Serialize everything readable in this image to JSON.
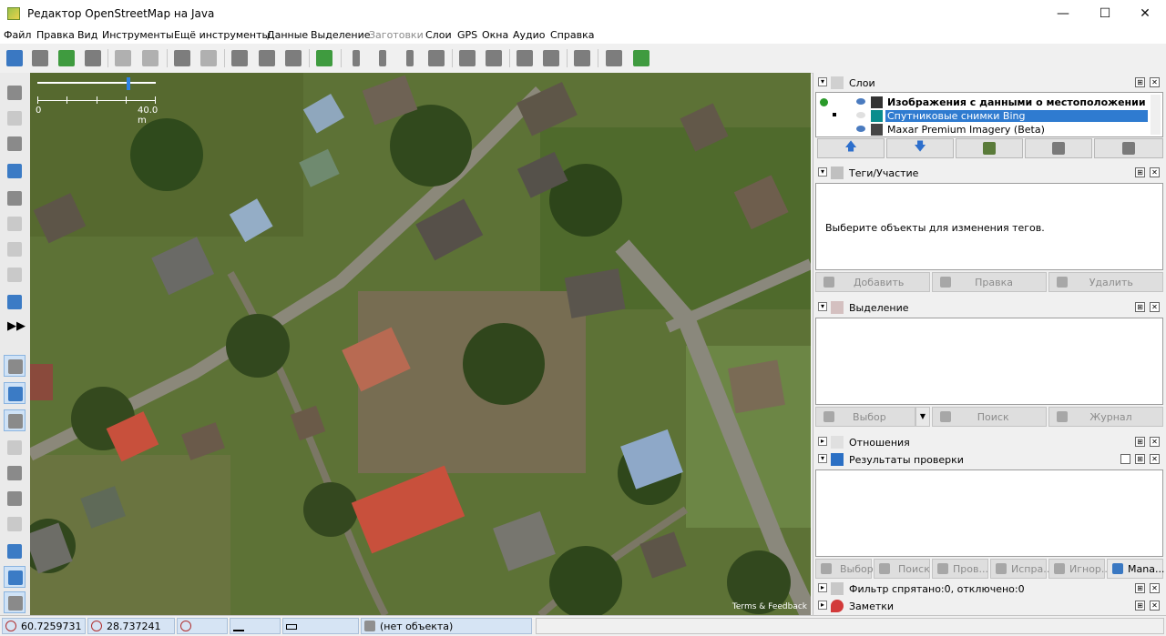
{
  "window": {
    "title": "Редактор OpenStreetMap на Java",
    "minimize": "—",
    "maximize": "☐",
    "close": "✕"
  },
  "menu": [
    {
      "label": "Файл",
      "enabled": true
    },
    {
      "label": "Правка",
      "enabled": true
    },
    {
      "label": "Вид",
      "enabled": true
    },
    {
      "label": "Инструменты",
      "enabled": true
    },
    {
      "label": "Ещё инструменты",
      "enabled": true
    },
    {
      "label": "Данные",
      "enabled": true
    },
    {
      "label": "Выделение",
      "enabled": true
    },
    {
      "label": "Заготовки",
      "enabled": false
    },
    {
      "label": "Слои",
      "enabled": true
    },
    {
      "label": "GPS",
      "enabled": true
    },
    {
      "label": "Окна",
      "enabled": true
    },
    {
      "label": "Аудио",
      "enabled": true
    },
    {
      "label": "Справка",
      "enabled": true
    }
  ],
  "map": {
    "scale_start": "0",
    "scale_end": "40.0 m",
    "terms": "Terms & Feedback"
  },
  "layers_panel": {
    "title": "Слои",
    "layers": [
      {
        "name": "Изображения с данными о местоположении",
        "visible": true,
        "selected": false,
        "bold": true
      },
      {
        "name": "Спутниковые снимки Bing",
        "visible": false,
        "selected": true,
        "bold": false
      },
      {
        "name": "Maxar Premium Imagery (Beta)",
        "visible": true,
        "selected": false,
        "bold": false
      }
    ],
    "buttons": [
      "move-up",
      "move-down",
      "merge",
      "visibility",
      "delete"
    ],
    "up_arrow": "🡅",
    "down_arrow": "🡇"
  },
  "tags_panel": {
    "title": "Теги/Участие",
    "empty_message": "Выберите объекты для изменения тегов.",
    "add": "Добавить",
    "edit": "Правка",
    "delete": "Удалить"
  },
  "selection_panel": {
    "title": "Выделение",
    "select": "Выбор",
    "dropdown_arrow": "▼",
    "search": "Поиск",
    "history": "Журнал"
  },
  "relations_panel": {
    "title": "Отношения"
  },
  "validation_panel": {
    "title": "Результаты проверки",
    "select": "Выбор",
    "search": "Поиск",
    "validate": "Пров...",
    "fix": "Испра...",
    "ignore": "Игнор...",
    "manage": "Mana..."
  },
  "filter_panel": {
    "title": "Фильтр спрятано:0, отключено:0"
  },
  "notes_panel": {
    "title": "Заметки"
  },
  "status": {
    "lat": "60.7259731",
    "lon": "28.737241",
    "object": "(нет объекта)"
  },
  "panel_controls": {
    "collapse": "▾",
    "expand": "▸",
    "detach": "⊞",
    "close": "✕"
  },
  "colors": {
    "selection": "#2f7bd0",
    "status_field": "#d6e4f4",
    "roof_red": "#c8503c"
  },
  "icons": [
    "search-icon",
    "checkmark-icon",
    "eye-icon",
    "pin-icon",
    "filter-icon",
    "compass-icon"
  ]
}
